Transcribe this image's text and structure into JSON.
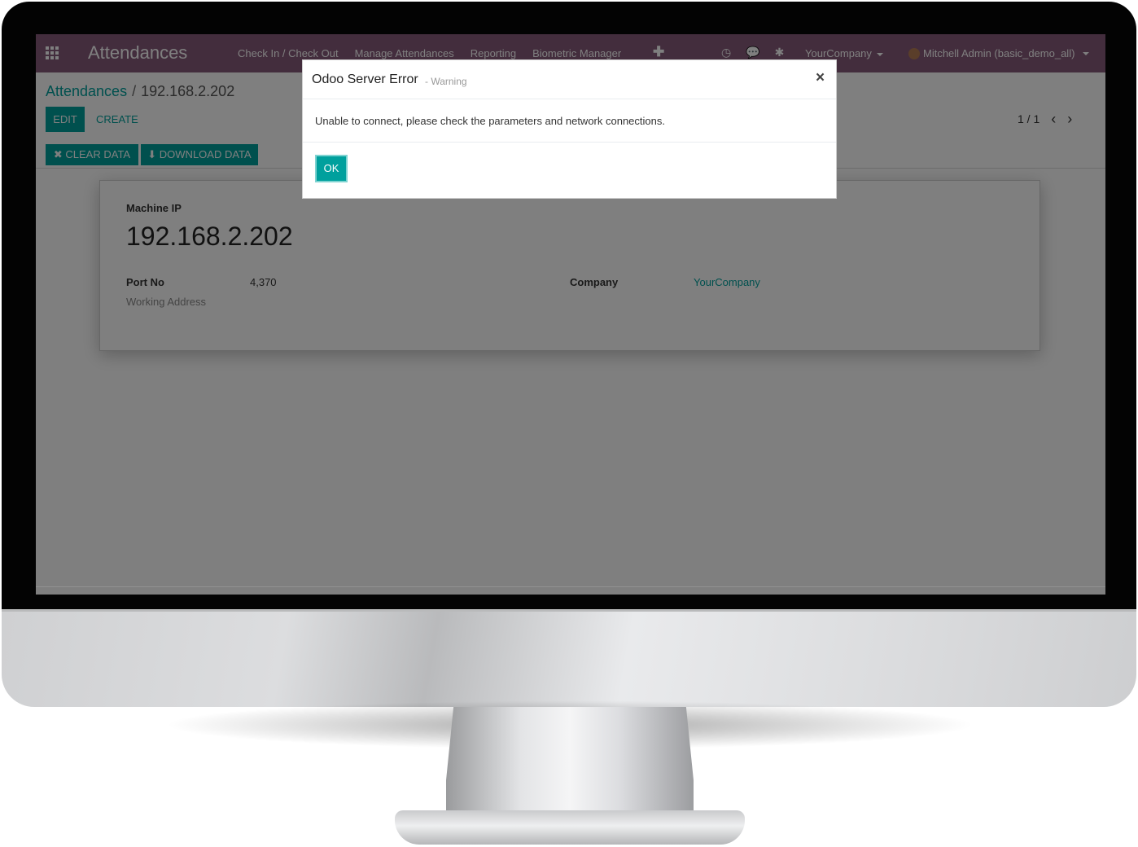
{
  "navbar": {
    "app_title": "Attendances",
    "menu": [
      "Check In / Check Out",
      "Manage Attendances",
      "Reporting",
      "Biometric Manager"
    ],
    "plus_symbol": "✚",
    "clock_symbol": "◷",
    "chat_symbol": "💬",
    "bug_symbol": "✱",
    "company": "YourCompany",
    "user": "Mitchell Admin (basic_demo_all)"
  },
  "control_panel": {
    "breadcrumb_root": "Attendances",
    "breadcrumb_sep": "/",
    "breadcrumb_current": "192.168.2.202",
    "edit_label": "EDIT",
    "create_label": "CREATE",
    "pager": "1 / 1",
    "prev_symbol": "‹",
    "next_symbol": "›",
    "clear_data_label": "✖ CLEAR DATA",
    "download_data_label": "⬇ DOWNLOAD DATA"
  },
  "form": {
    "machine_ip_label": "Machine IP",
    "machine_ip": "192.168.2.202",
    "port_label": "Port No",
    "port_value": "4,370",
    "working_address_label": "Working Address",
    "company_label": "Company",
    "company_value": "YourCompany"
  },
  "dialog": {
    "title": "Odoo Server Error",
    "subtitle": "- Warning",
    "close_symbol": "×",
    "message": "Unable to connect, please check the parameters and network connections.",
    "ok_label": "OK"
  },
  "colors": {
    "navbar": "#875a7b",
    "accent": "#00a09d"
  }
}
